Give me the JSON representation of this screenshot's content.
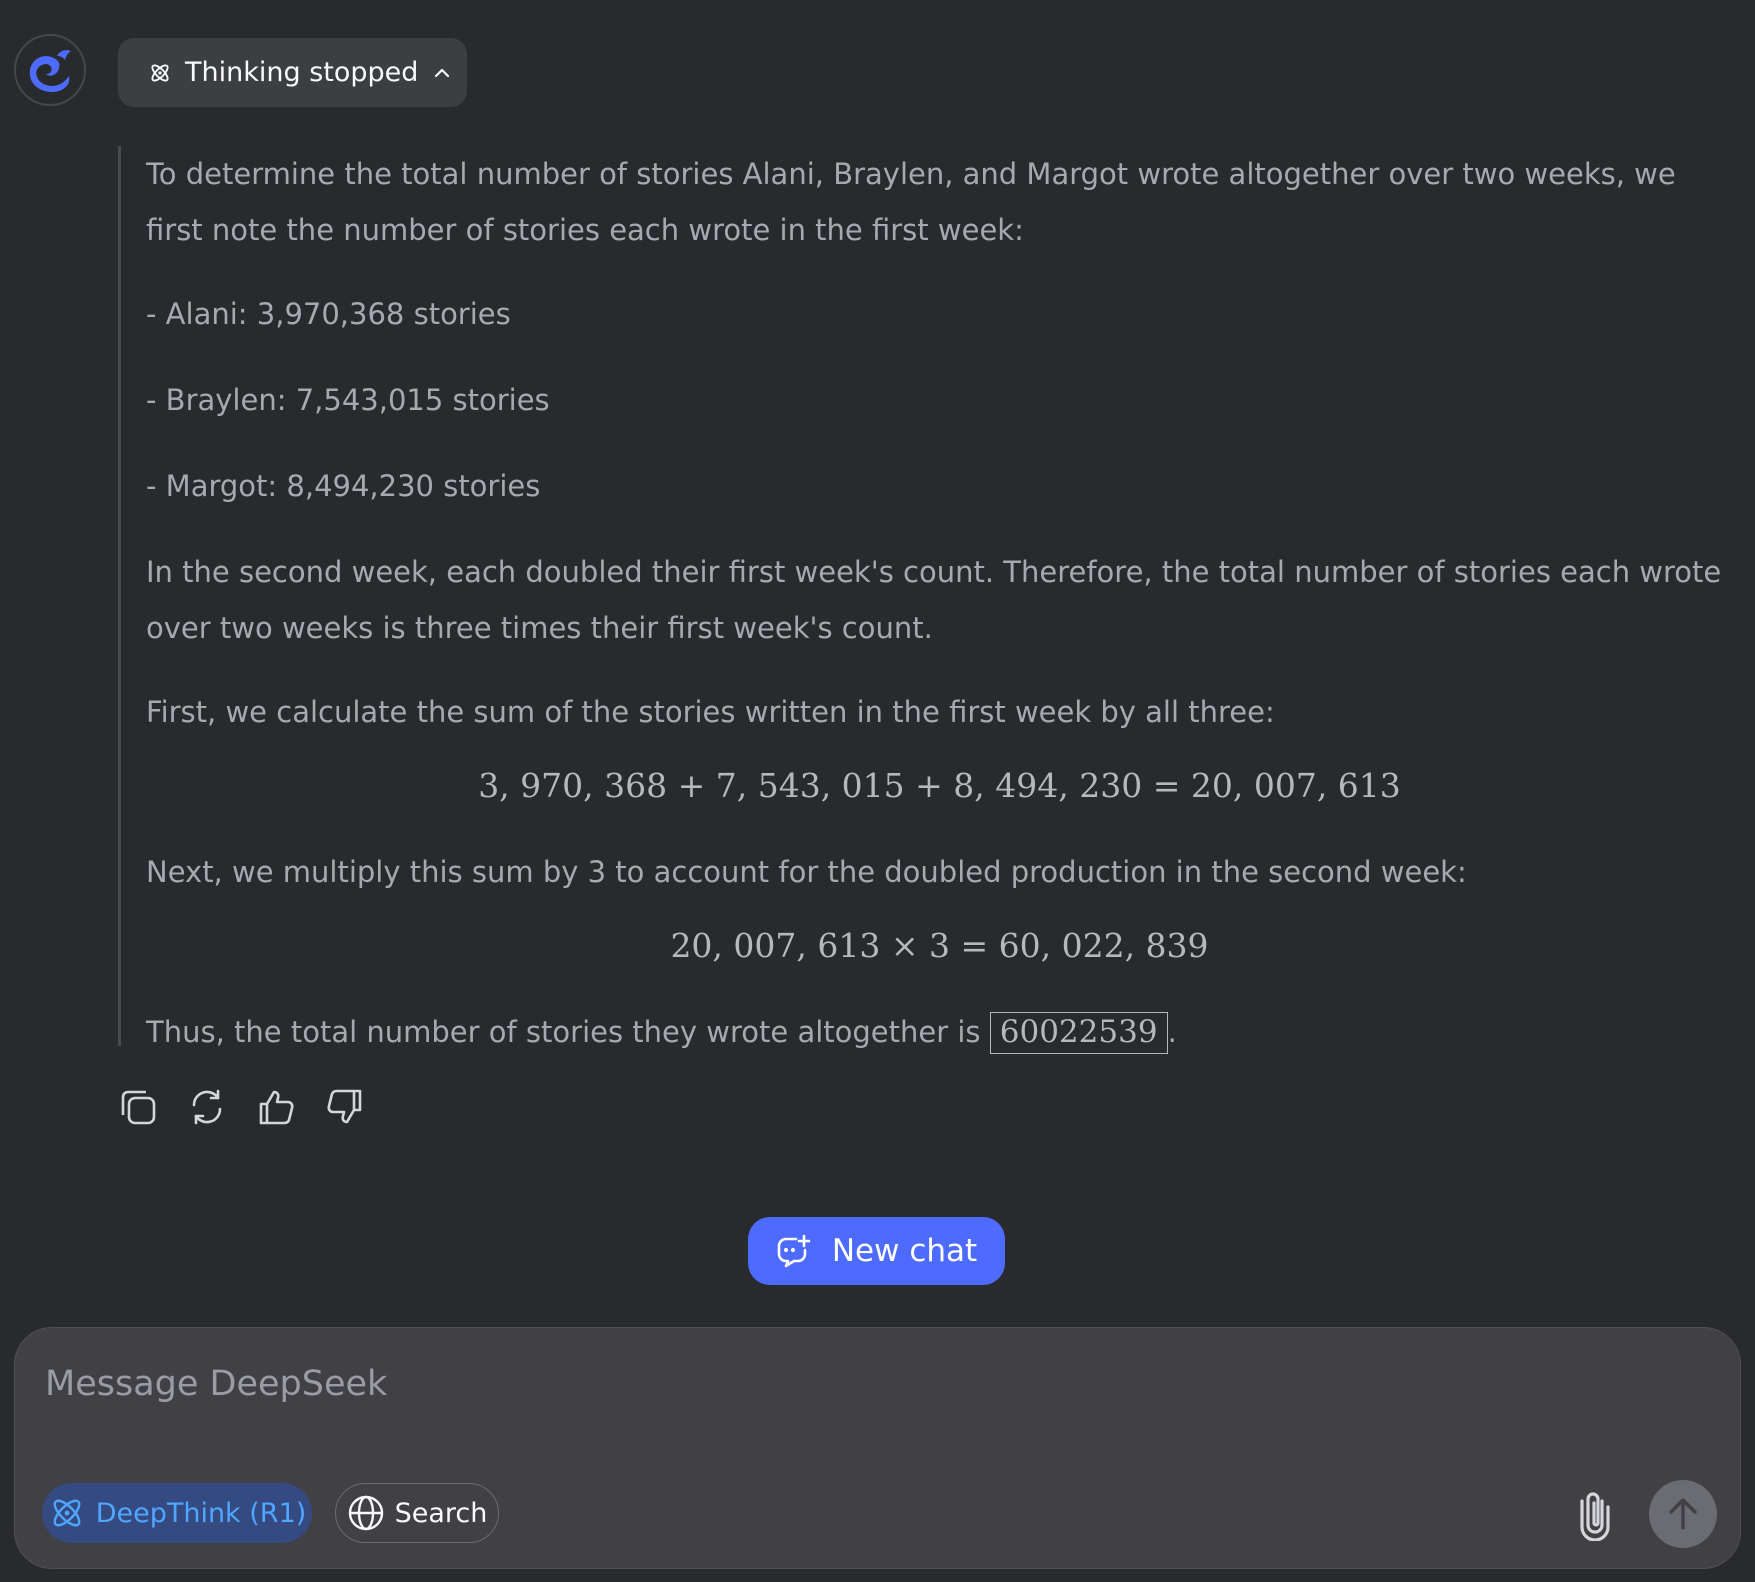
{
  "thinking": {
    "label": "Thinking stopped",
    "icon": "atom-icon",
    "toggle_icon": "chevron-up-icon"
  },
  "reasoning": {
    "intro": "To determine the total number of stories Alani, Braylen, and Margot wrote altogether over two weeks, we first note the number of stories each wrote in the first week:",
    "items": [
      "- Alani: 3,970,368 stories",
      "- Braylen: 7,543,015 stories",
      "- Margot: 8,494,230 stories"
    ],
    "second_week": "In the second week, each doubled their first week's count. Therefore, the total number of stories each wrote over two weeks is three times their first week's count.",
    "first_step": "First, we calculate the sum of the stories written in the first week by all three:",
    "equation_sum": "3, 970, 368 + 7, 543, 015 + 8, 494, 230 = 20, 007, 613",
    "next_step": "Next, we multiply this sum by 3 to account for the doubled production in the second week:",
    "equation_product": "20, 007, 613 × 3 = 60, 022, 839",
    "conclusion_prefix": "Thus, the total number of stories they wrote altogether is ",
    "answer": "60022539",
    "conclusion_suffix": "."
  },
  "actions": [
    "copy-icon",
    "regenerate-icon",
    "thumbs-up-icon",
    "thumbs-down-icon"
  ],
  "new_chat": {
    "label": "New chat"
  },
  "composer": {
    "placeholder": "Message DeepSeek",
    "deepthink_label": "DeepThink (R1)",
    "search_label": "Search"
  },
  "colors": {
    "background": "#292a2d",
    "accent": "#4d6bfe",
    "deepthink_text": "#4ea6ff",
    "deepthink_bg": "#344a80",
    "composer_bg": "#404045",
    "reasoning_text": "#a7a9b0"
  }
}
